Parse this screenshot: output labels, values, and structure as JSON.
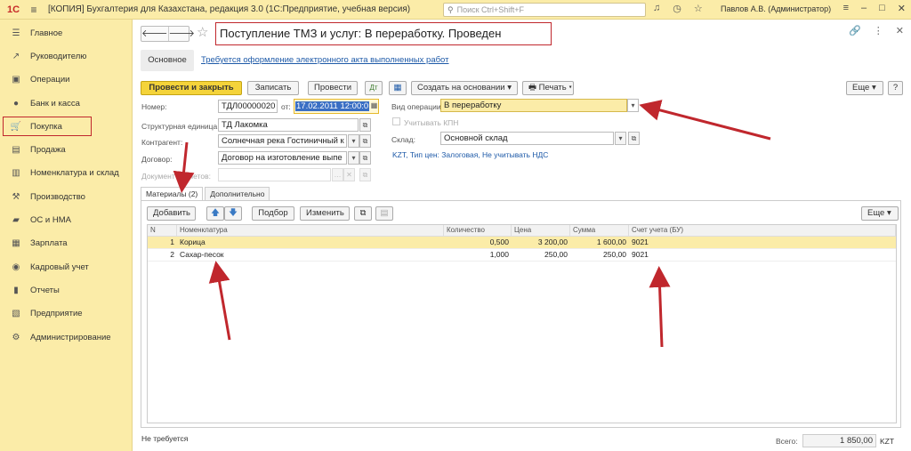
{
  "titlebar": {
    "logo": "1С",
    "title": "[КОПИЯ] Бухгалтерия для Казахстана, редакция 3.0  (1С:Предприятие, учебная версия)",
    "search_placeholder": "Поиск Ctrl+Shift+F",
    "user": "Павлов А.В. (Администратор)"
  },
  "sidebar": {
    "items": [
      {
        "label": "Главное",
        "icon": "home-icon",
        "glyph": "☰"
      },
      {
        "label": "Руководителю",
        "icon": "chart-icon",
        "glyph": "↗"
      },
      {
        "label": "Операции",
        "icon": "operations-icon",
        "glyph": "▣"
      },
      {
        "label": "Банк и касса",
        "icon": "bank-icon",
        "glyph": "●"
      },
      {
        "label": "Покупка",
        "icon": "cart-icon",
        "glyph": "🛒"
      },
      {
        "label": "Продажа",
        "icon": "sale-icon",
        "glyph": "▤"
      },
      {
        "label": "Номенклатура и склад",
        "icon": "warehouse-icon",
        "glyph": "▥"
      },
      {
        "label": "Производство",
        "icon": "production-icon",
        "glyph": "⚒"
      },
      {
        "label": "ОС и НМА",
        "icon": "assets-icon",
        "glyph": "▰"
      },
      {
        "label": "Зарплата",
        "icon": "salary-icon",
        "glyph": "▦"
      },
      {
        "label": "Кадровый учет",
        "icon": "people-icon",
        "glyph": "◉"
      },
      {
        "label": "Отчеты",
        "icon": "reports-icon",
        "glyph": "▮"
      },
      {
        "label": "Предприятие",
        "icon": "enterprise-icon",
        "glyph": "▧"
      },
      {
        "label": "Администрирование",
        "icon": "gear-icon",
        "glyph": "⚙"
      }
    ]
  },
  "document": {
    "title": "Поступление ТМЗ и услуг: В переработку. Проведен",
    "tab_main": "Основное",
    "act_link": "Требуется оформление электронного акта выполненных работ"
  },
  "toolbar": {
    "post_close": "Провести и закрыть",
    "save": "Записать",
    "post": "Провести",
    "create_based": "Создать на основании",
    "print": "Печать",
    "more": "Еще",
    "help": "?"
  },
  "form": {
    "number_label": "Номер:",
    "number_value": "ТДЛ00000020",
    "date_label": "от:",
    "date_value": "17.02.2011 12:00:0",
    "unit_label": "Структурная единица:",
    "unit_value": "ТД Лакомка",
    "counterparty_label": "Контрагент:",
    "counterparty_value": "Солнечная река Гостиничный к",
    "contract_label": "Договор:",
    "contract_value": "Договор на изготовление выпе",
    "settlement_label": "Документ расчетов:",
    "settlement_value": "",
    "operation_label": "Вид операции:",
    "operation_value": "В переработку",
    "kpn_label": "Учитывать КПН",
    "warehouse_label": "Склад:",
    "warehouse_value": "Основной склад",
    "info_line": "KZT, Тип цен: Залоговая, Не учитывать НДС"
  },
  "tabs": {
    "materials": "Материалы (2)",
    "additional": "Дополнительно"
  },
  "grid_toolbar": {
    "add": "Добавить",
    "pick": "Подбор",
    "change": "Изменить",
    "more": "Еще"
  },
  "table": {
    "headers": [
      "N",
      "Номенклатура",
      "Количество",
      "Цена",
      "Сумма",
      "Счет учета (БУ)"
    ],
    "rows": [
      [
        "1",
        "Корица",
        "0,500",
        "3 200,00",
        "1 600,00",
        "9021"
      ],
      [
        "2",
        "Сахар-песок",
        "1,000",
        "250,00",
        "250,00",
        "9021"
      ]
    ]
  },
  "footer": {
    "comment": "Не требуется",
    "total_label": "Всего:",
    "total_value": "1 850,00",
    "currency": "KZT"
  },
  "colors": {
    "accent_yellow": "#fbeca8",
    "primary_button": "#f4d33a",
    "annotation_red": "#c0272d",
    "link_blue": "#1e5aa8"
  }
}
